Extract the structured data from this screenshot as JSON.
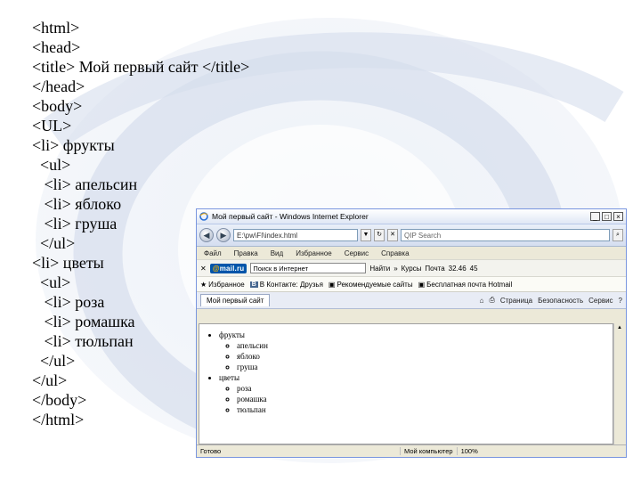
{
  "code_lines": [
    "<html>",
    "<head>",
    "<title> Мой первый сайт </title>",
    "</head>",
    "<body>",
    "<UL>",
    "<li> фрукты",
    "  <ul>",
    "   <li> апельсин",
    "   <li> яблоко",
    "   <li> груша",
    "  </ul>",
    "<li> цветы",
    "  <ul>",
    "   <li> роза",
    "   <li> ромашка",
    "   <li> тюльпан",
    "  </ul>",
    "</ul>",
    "</body>",
    "</html>"
  ],
  "browser": {
    "window_title": "Мой первый сайт - Windows Internet Explorer",
    "address": "E:\\pw\\FI\\index.html",
    "search_placeholder": "QIP Search",
    "menu": [
      "Файл",
      "Правка",
      "Вид",
      "Избранное",
      "Сервис",
      "Справка"
    ],
    "toolbar": {
      "close": "✕",
      "brand_prefix": "@",
      "brand_name": "mail.ru",
      "search_value": "Поиск в Интернет",
      "find_label": "Найти",
      "more_label": "»",
      "weather": "Курсы",
      "mail": "Почта",
      "rate": "32.46",
      "rate2": "45"
    },
    "favorites": {
      "label": "Избранное",
      "items": [
        "В Контакте: Друзья",
        "Рекомендуемые сайты",
        "Бесплатная почта Hotmail"
      ]
    },
    "tab": {
      "label": "Мой первый сайт",
      "commands": [
        "Страница",
        "Безопасность",
        "Сервис"
      ]
    },
    "page": {
      "list": [
        {
          "label": "фрукты",
          "children": [
            "апельсин",
            "яблоко",
            "груша"
          ]
        },
        {
          "label": "цветы",
          "children": [
            "роза",
            "ромашка",
            "тюльпан"
          ]
        }
      ]
    },
    "status": {
      "text": "Готово",
      "zone": "Мой компьютер",
      "zoom": "100%"
    }
  }
}
